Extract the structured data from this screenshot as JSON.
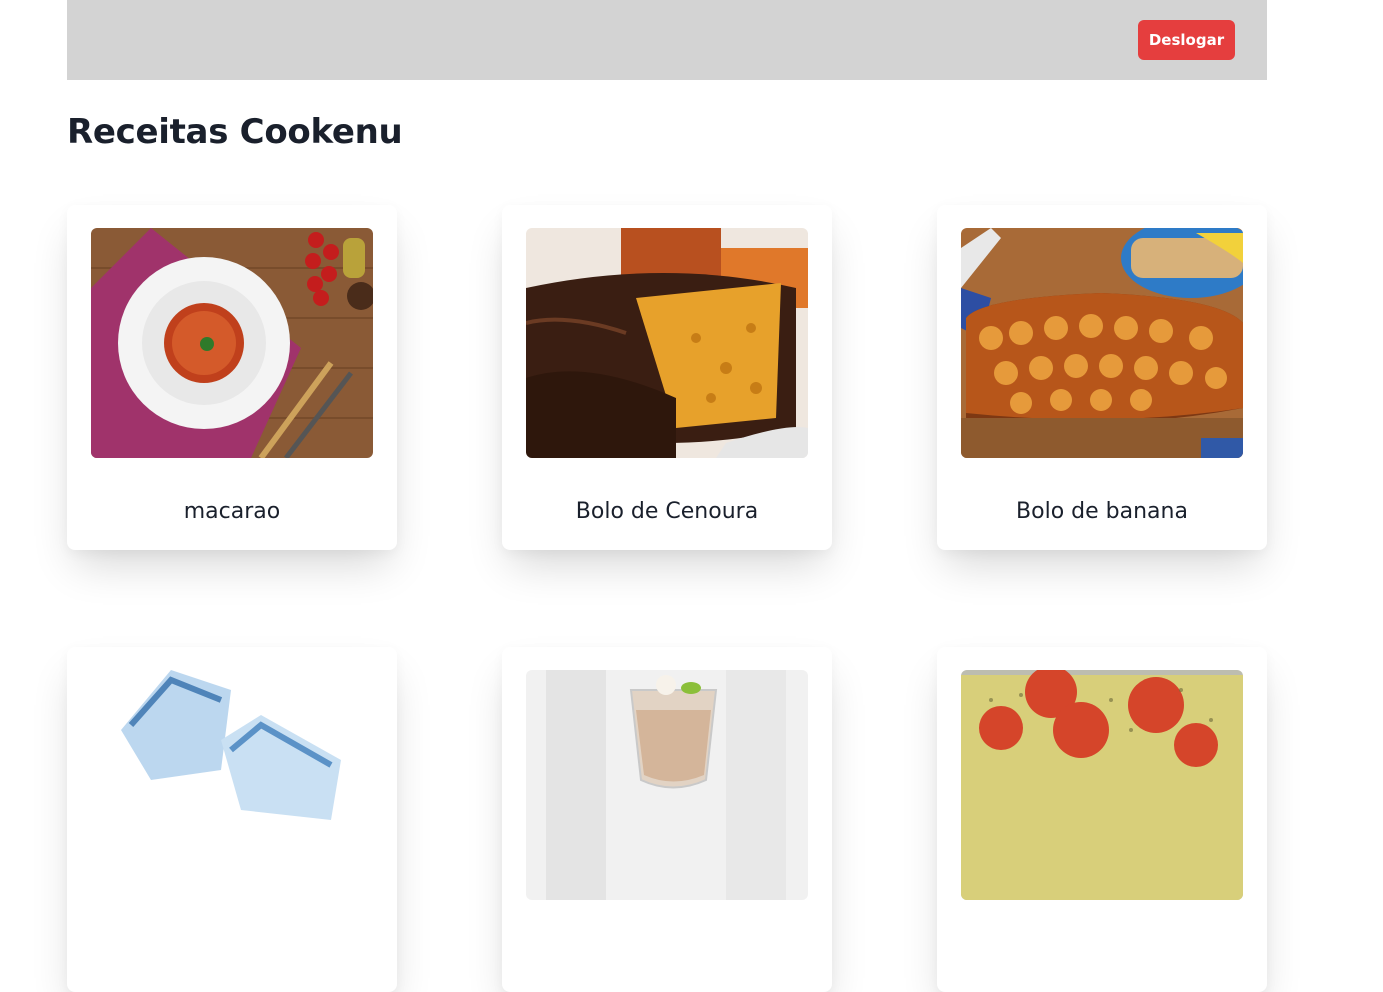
{
  "header": {
    "logout_label": "Deslogar",
    "color": "#d3d3d3",
    "button_color": "#e53e3e"
  },
  "page": {
    "title": "Receitas Cookenu"
  },
  "recipes": [
    {
      "name": "macarao",
      "image": "spaghetti-plate"
    },
    {
      "name": "Bolo de Cenoura",
      "image": "carrot-cake-chocolate"
    },
    {
      "name": "Bolo de banana",
      "image": "banana-cake"
    },
    {
      "name": "",
      "image": "ice-cubes"
    },
    {
      "name": "",
      "image": "dessert-glass"
    },
    {
      "name": "",
      "image": "tomato-casserole"
    }
  ]
}
